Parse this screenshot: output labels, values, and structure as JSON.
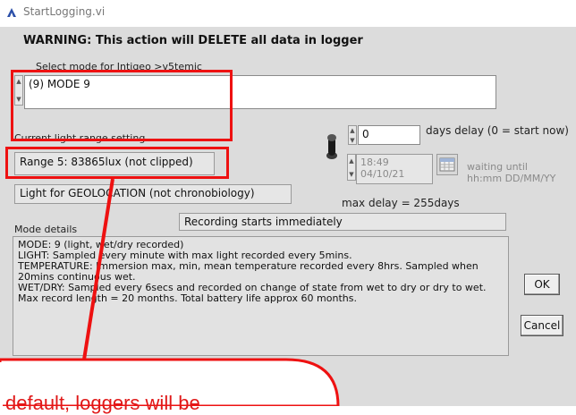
{
  "window": {
    "title": "StartLogging.vi",
    "warning": "WARNING: This action will DELETE all data in logger"
  },
  "mode": {
    "label": "Select mode for Intigeo >v5temic",
    "value": "(9) MODE 9"
  },
  "light_range": {
    "label": "Current light range setting",
    "value": "Range 5: 83865lux (not clipped)"
  },
  "light_use": "Light for GEOLOCATION (not chronobiology)",
  "delay": {
    "value": "0",
    "label": "days delay (0 = start now)",
    "time": "18:49",
    "date": "04/10/21",
    "waiting_label_1": "waiting until",
    "waiting_label_2": "hh:mm DD/MM/YY",
    "max_delay": "max delay = 255days"
  },
  "recording_status": "Recording starts immediately",
  "details": {
    "label": "Mode details",
    "lines": [
      "MODE: 9 (light, wet/dry recorded)",
      "LIGHT: Sampled every minute with max light recorded every 5mins.",
      "TEMPERATURE: Immersion max, min, mean temperature recorded every 8hrs. Sampled when 20mins continuous wet.",
      "WET/DRY: Sampled every 6secs and recorded on change of state from wet to dry or dry to wet.",
      "Max record length = 20 months. Total battery life approx 60 months."
    ]
  },
  "buttons": {
    "ok": "OK",
    "cancel": "Cancel"
  },
  "annotation": {
    "text": "default, loggers will be",
    "color": "#ee1111"
  }
}
